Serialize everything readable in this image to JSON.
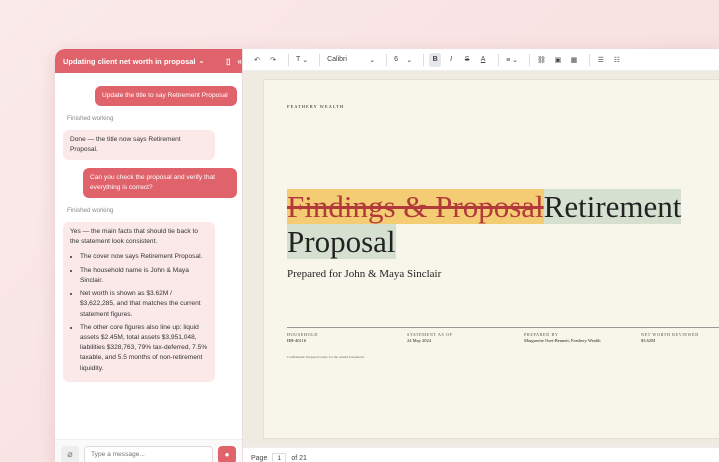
{
  "chat": {
    "header_title": "Updating client net worth in proposal",
    "messages": [
      {
        "role": "user",
        "text": "Update the title to say Retirement Proposal"
      },
      {
        "role": "status",
        "text": "Finished working"
      },
      {
        "role": "bot",
        "text": "Done — the title now says Retirement Proposal."
      },
      {
        "role": "user",
        "text": "Can you check the proposal and verify that everything is correct?"
      },
      {
        "role": "status",
        "text": "Finished working"
      },
      {
        "role": "bot",
        "intro": "Yes — the main facts that should tie back to the statement look consistent.",
        "bullets": [
          "The cover now says Retirement Proposal.",
          "The household name is John & Maya Sinclair.",
          "Net worth is shown as $3.62M / $3,622,285, and that matches the current statement figures.",
          "The other core figures also line up: liquid assets $2.45M, total assets $3,951,048, liabilities $328,763, 79% tax-deferred, 7.5% taxable, and 5.5 months of non-retirement liquidity."
        ]
      }
    ],
    "input_placeholder": "Type a message..."
  },
  "toolbar": {
    "font": "Calibri",
    "size": "6",
    "text_style": "T"
  },
  "document": {
    "firm": "FEATHERY WEALTH",
    "title_old": "Findings & Proposal",
    "title_new_1": "Retirement",
    "title_new_2": "Proposal",
    "subtitle": "Prepared for John & Maya Sinclair",
    "meta": [
      {
        "key": "HOUSEHOLD",
        "value": "HH-40116"
      },
      {
        "key": "STATEMENT AS OF",
        "value": "24 May 2024"
      },
      {
        "key": "PREPARED BY",
        "value": "Marguerite Osei-Bennett, Feathery Wealth"
      },
      {
        "key": "NET WORTH REVIEWED",
        "value": "$3.62M"
      }
    ],
    "confidential": "Confidential. Prepared solely for the named household."
  },
  "statusbar": {
    "page_label": "Page",
    "page_current": "1",
    "of_label": "of",
    "page_total": "21"
  },
  "colors": {
    "accent": "#e0636b",
    "strike_highlight": "#f3cc74",
    "new_highlight": "#d6e0d0"
  }
}
